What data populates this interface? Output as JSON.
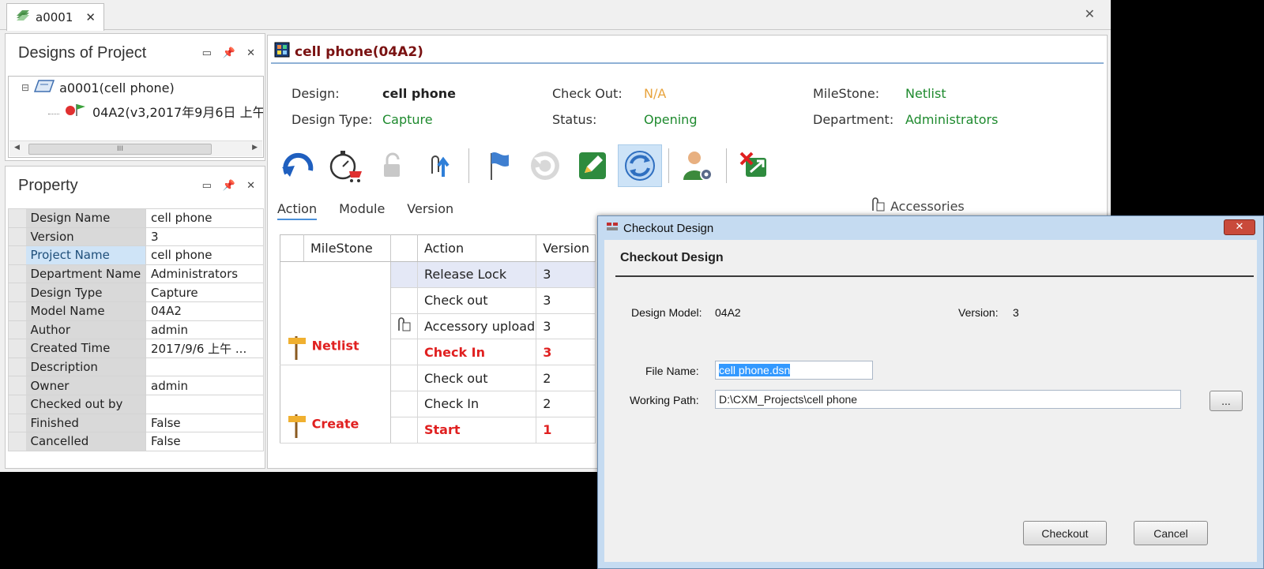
{
  "doc_tab": {
    "label": "a0001",
    "close": "✕"
  },
  "main_close": "✕",
  "designs_panel": {
    "title": "Designs of Project",
    "tree": {
      "root": "a0001(cell phone)",
      "child": "04A2(v3,2017年9月6日 上午"
    },
    "scroll_thumb": "III"
  },
  "property_panel": {
    "title": "Property",
    "rows": [
      {
        "key": "Design Name",
        "value": "cell phone"
      },
      {
        "key": "Version",
        "value": "3"
      },
      {
        "key": "Project Name",
        "value": "cell phone"
      },
      {
        "key": "Department Name",
        "value": "Administrators"
      },
      {
        "key": "Design Type",
        "value": "Capture"
      },
      {
        "key": "Model Name",
        "value": "04A2"
      },
      {
        "key": "Author",
        "value": "admin"
      },
      {
        "key": "Created Time",
        "value": "2017/9/6 上午 ..."
      },
      {
        "key": "Description",
        "value": ""
      },
      {
        "key": "Owner",
        "value": "admin"
      },
      {
        "key": "Checked out by",
        "value": ""
      },
      {
        "key": "Finished",
        "value": "False"
      },
      {
        "key": "Cancelled",
        "value": "False"
      }
    ]
  },
  "detail": {
    "title": "cell phone(04A2)",
    "info": {
      "design_label": "Design:",
      "design_value": "cell phone",
      "type_label": "Design Type:",
      "type_value": "Capture",
      "checkout_label": "Check Out:",
      "checkout_value": "N/A",
      "status_label": "Status:",
      "status_value": "Opening",
      "milestone_label": "MileStone:",
      "milestone_value": "Netlist",
      "department_label": "Department:",
      "department_value": "Administrators"
    },
    "tabs": [
      "Action",
      "Module",
      "Version"
    ],
    "accessories_label": "Accessories",
    "grid": {
      "headers": {
        "milestone": "MileStone",
        "action": "Action",
        "version": "Version"
      },
      "milestones": [
        "Netlist",
        "Create"
      ],
      "rows": [
        {
          "action": "Release Lock",
          "version": "3"
        },
        {
          "action": "Check out",
          "version": "3"
        },
        {
          "action": "Accessory upload",
          "version": "3"
        },
        {
          "action": "Check In",
          "version": "3"
        },
        {
          "action": "Check out",
          "version": "2"
        },
        {
          "action": "Check In",
          "version": "2"
        },
        {
          "action": "Start",
          "version": "1"
        }
      ]
    }
  },
  "dialog": {
    "title": "Checkout Design",
    "close": "✕",
    "heading": "Checkout Design",
    "model_label": "Design Model:",
    "model_value": "04A2",
    "version_label": "Version:",
    "version_value": "3",
    "file_label": "File Name:",
    "file_value": "cell phone.dsn",
    "path_label": "Working Path:",
    "path_value": "D:\\CXM_Projects\\cell phone",
    "browse_label": "...",
    "checkout_button": "Checkout",
    "cancel_button": "Cancel"
  },
  "colors": {
    "accent_orange": "#e8a33c",
    "value_green": "#1e8a2e",
    "milestone_red": "#e02020",
    "title_maroon": "#7a1212",
    "selection_blue": "#3399ff"
  }
}
